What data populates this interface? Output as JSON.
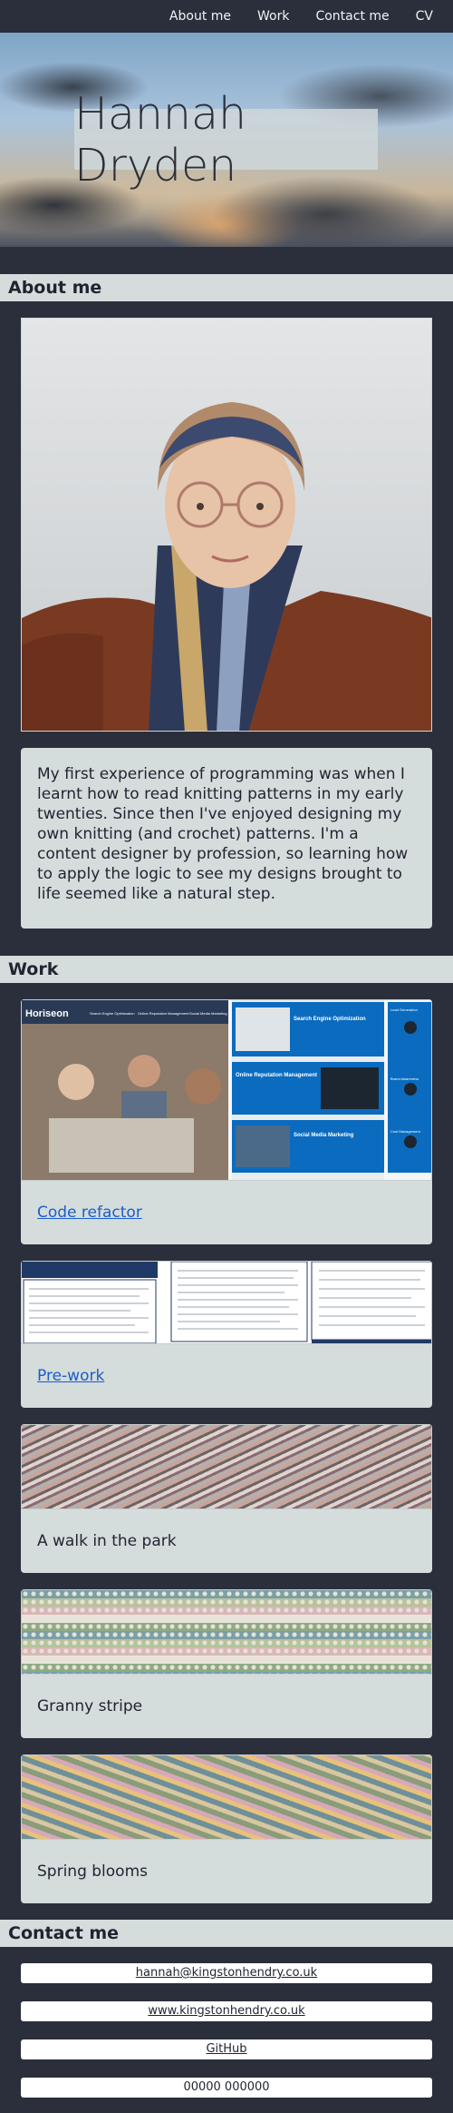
{
  "nav": {
    "items": [
      "About me",
      "Work",
      "Contact me",
      "CV"
    ]
  },
  "hero": {
    "title": "Hannah Dryden"
  },
  "about": {
    "heading": "About me",
    "text": "My first experience of programming was when I learnt how to read knitting patterns in my early twenties. Since then I've enjoyed designing my own knitting (and crochet) patterns. I'm a content designer by profession, so learning how to apply the logic to see my designs brought to life seemed like a natural step."
  },
  "work": {
    "heading": "Work",
    "items": [
      {
        "label": "Code refactor",
        "link": true
      },
      {
        "label": "Pre-work",
        "link": true
      },
      {
        "label": "A walk in the park",
        "link": false
      },
      {
        "label": "Granny stripe",
        "link": false
      },
      {
        "label": "Spring blooms",
        "link": false
      }
    ],
    "horiseon": {
      "brand": "Horiseon",
      "menu": [
        "Search Engine Optimization",
        "Online Reputation Management",
        "Social Media Marketing"
      ],
      "cards": [
        "Search Engine Optimization",
        "Online Reputation Management",
        "Social Media Marketing"
      ],
      "sidebar": [
        "Lead Generation",
        "Brand Awareness",
        "Cost Management"
      ]
    }
  },
  "contact": {
    "heading": "Contact me",
    "items": [
      "hannah@kingstonhendry.co.uk",
      "www.kingstonhendry.co.uk",
      "GitHub",
      "00000 000000"
    ]
  },
  "colors": {
    "background": "#2a2f3b",
    "panel": "#d5dcdc",
    "link": "#1a5ec7"
  }
}
